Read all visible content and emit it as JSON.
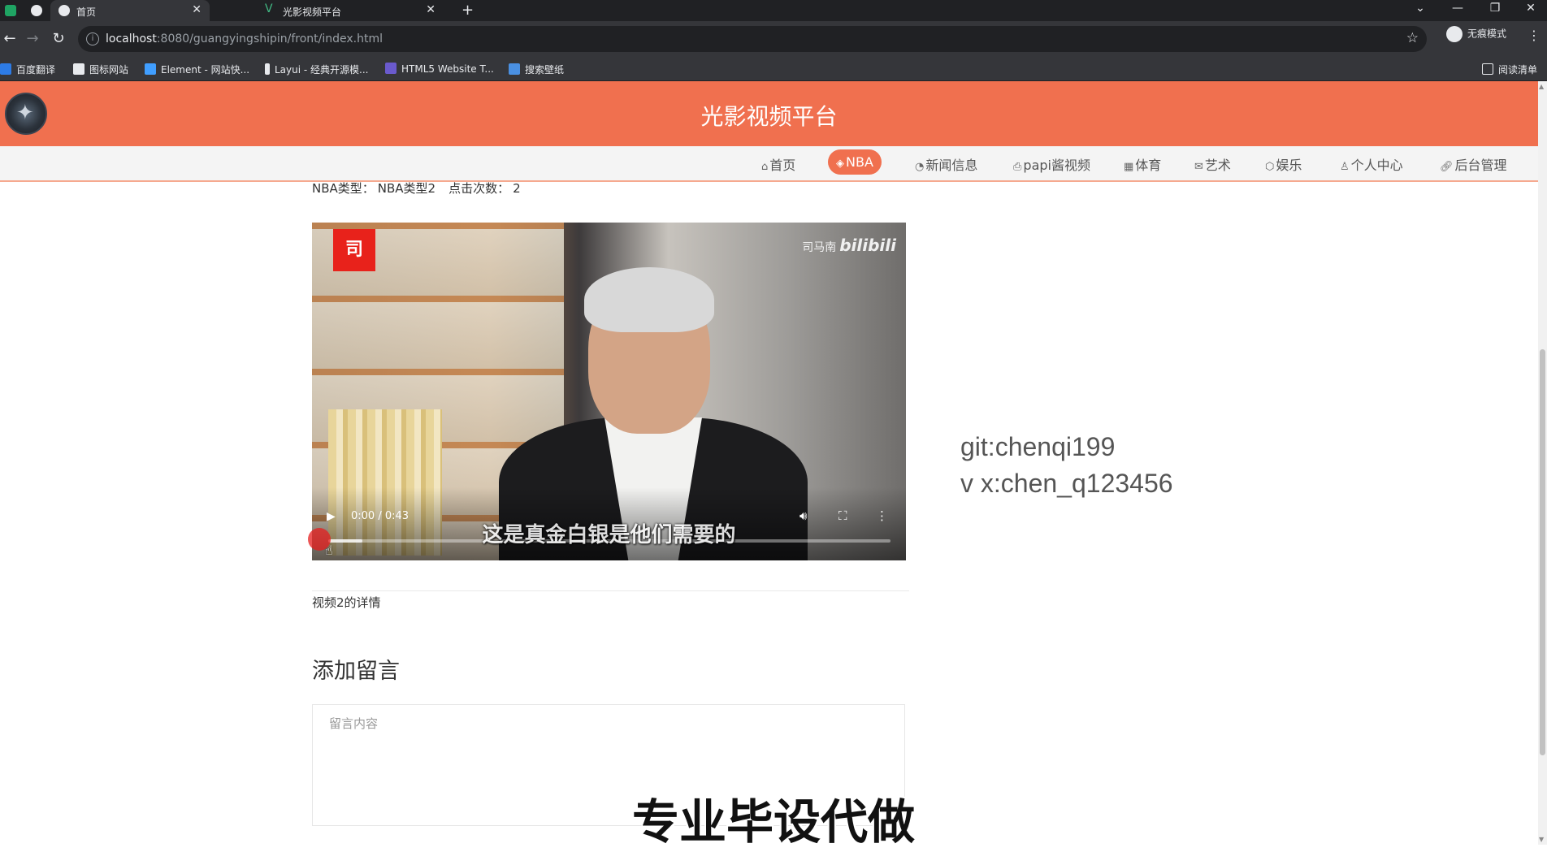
{
  "browser": {
    "tabs": [
      {
        "label": "首页",
        "active": true
      },
      {
        "label": "光影视频平台",
        "active": false
      }
    ],
    "new_tab": "+",
    "url_host": "localhost",
    "url_rest": ":8080/guangyingshipin/front/index.html",
    "incognito_label": "无痕模式",
    "bookmarks": [
      "百度翻译",
      "图标网站",
      "Element - 网站快...",
      "Layui - 经典开源模...",
      "HTML5 Website T...",
      "搜索壁纸"
    ],
    "reading_list": "阅读清单"
  },
  "site": {
    "title": "光影视频平台",
    "accent_color": "#f0704f"
  },
  "nav": {
    "items": [
      {
        "label": "首页",
        "icon": "home-icon",
        "active": false
      },
      {
        "label": "NBA",
        "icon": "cube-icon",
        "active": true
      },
      {
        "label": "新闻信息",
        "icon": "dashboard-icon",
        "active": false
      },
      {
        "label": "papi酱视频",
        "icon": "printer-icon",
        "active": false
      },
      {
        "label": "体育",
        "icon": "gift-icon",
        "active": false
      },
      {
        "label": "艺术",
        "icon": "mail-icon",
        "active": false
      },
      {
        "label": "娱乐",
        "icon": "box-icon",
        "active": false
      },
      {
        "label": "个人中心",
        "icon": "user-icon",
        "active": false
      },
      {
        "label": "后台管理",
        "icon": "link-icon",
        "active": false
      }
    ]
  },
  "detail": {
    "type_label": "NBA类型：",
    "type_value": "NBA类型2",
    "clicks_label": "点击次数：",
    "clicks_value": "2",
    "description": "视频2的详情"
  },
  "video": {
    "badge": "司",
    "watermark_name": "司马南",
    "watermark_brand": "bilibili",
    "subtitle": "这是真金白银是他们需要的",
    "time": "0:00 / 0:43",
    "progress": 0.0,
    "buffered": 0.06
  },
  "comment": {
    "section_title": "添加留言",
    "placeholder": "留言内容",
    "value": ""
  },
  "side_note": {
    "line1": "git:chenqi199",
    "line2": "v x:chen_q123456"
  },
  "overlay_caption": "专业毕设代做"
}
